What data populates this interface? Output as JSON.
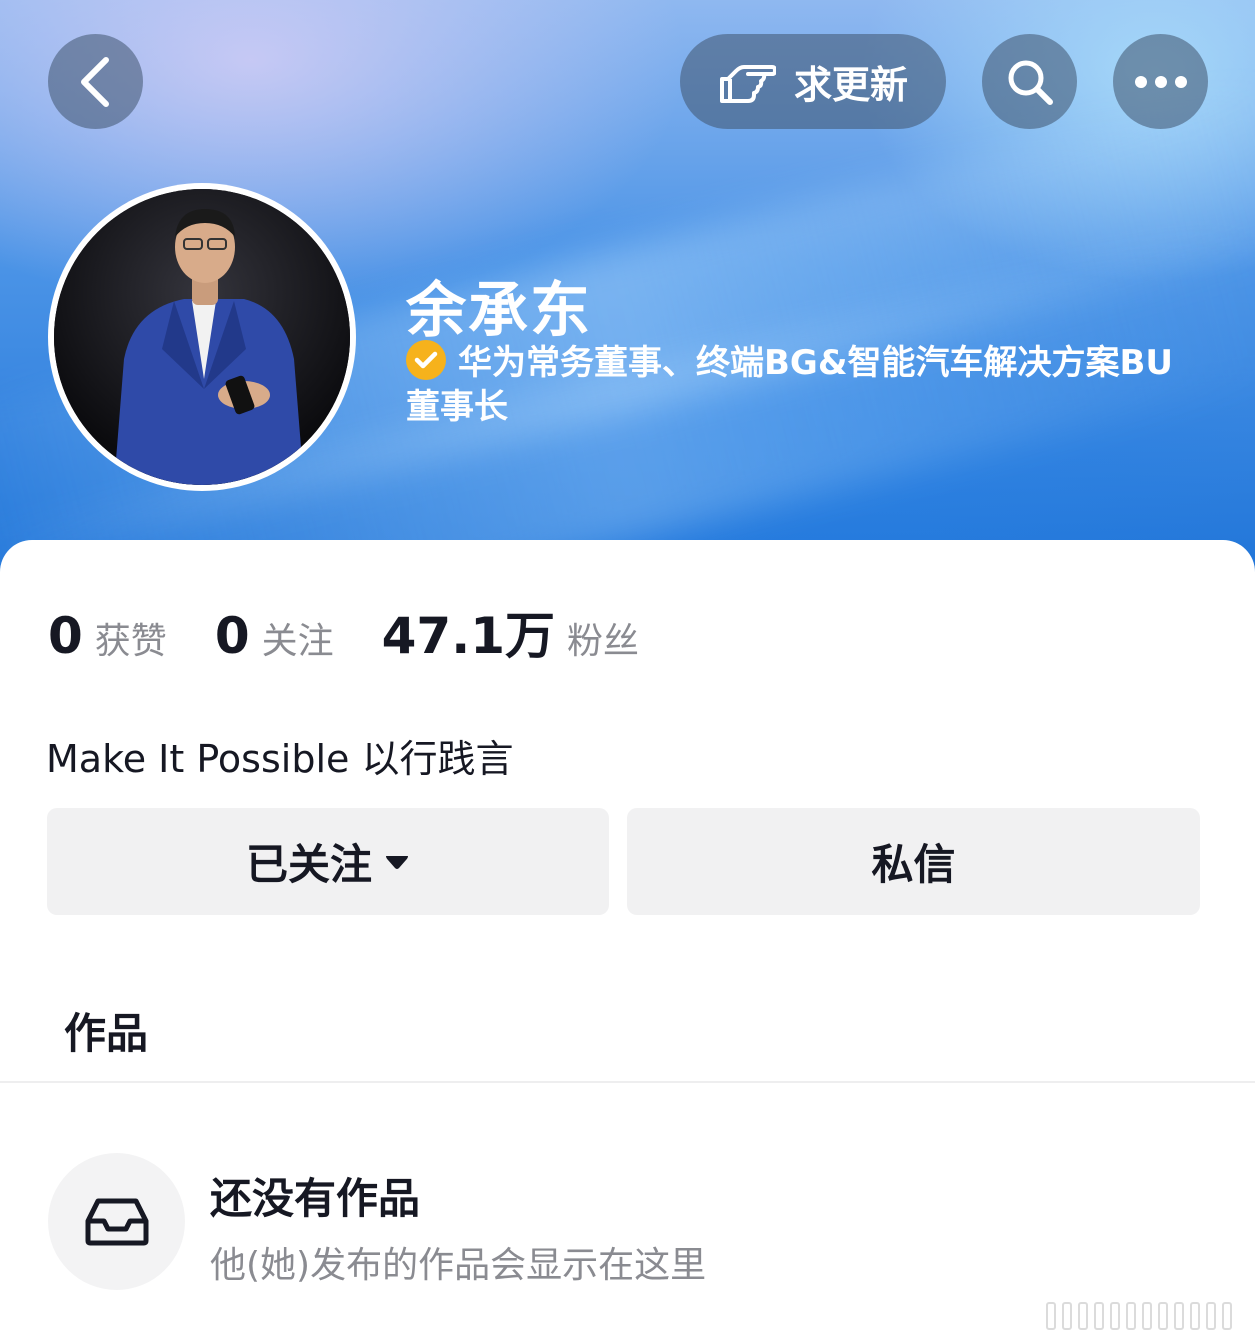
{
  "header": {
    "request_update_label": "求更新",
    "back_icon": "chevron-left-icon",
    "search_icon": "search-icon",
    "more_icon": "more-dots-icon",
    "hand_icon": "pointing-hand-icon"
  },
  "profile": {
    "name": "余承东",
    "verification": "华为常务董事、终端BG&智能汽车解决方案BU董事长",
    "verify_badge_color": "#f6b21c"
  },
  "stats": [
    {
      "value": "0",
      "label": "获赞"
    },
    {
      "value": "0",
      "label": "关注"
    },
    {
      "value": "47.1万",
      "label": "粉丝"
    }
  ],
  "bio": "Make It Possible 以行践言",
  "actions": {
    "following_label": "已关注",
    "message_label": "私信"
  },
  "tabs": {
    "works_label": "作品"
  },
  "empty_state": {
    "title": "还没有作品",
    "subtitle": "他(她)发布的作品会显示在这里",
    "icon": "inbox-tray-icon"
  }
}
